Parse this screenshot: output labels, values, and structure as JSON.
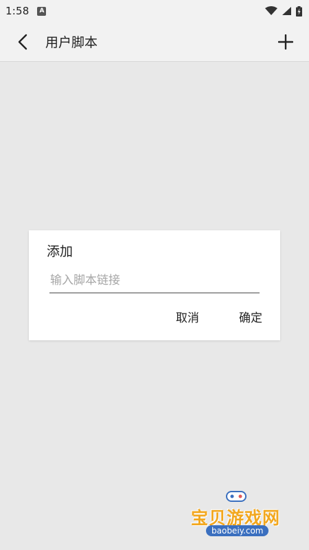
{
  "status_bar": {
    "time": "1:58",
    "notification_letter": "A"
  },
  "app_bar": {
    "title": "用户脚本"
  },
  "dialog": {
    "title": "添加",
    "input_placeholder": "输入脚本链接",
    "input_value": "",
    "cancel_label": "取消",
    "confirm_label": "确定"
  },
  "watermark": {
    "name": "宝贝游戏网",
    "url": "baobeiy.com"
  },
  "colors": {
    "background": "#e8e8e8",
    "app_bar": "#f2f2f2",
    "dialog": "#ffffff",
    "watermark_orange": "#f2a71f",
    "watermark_blue": "#3a6fbf"
  }
}
